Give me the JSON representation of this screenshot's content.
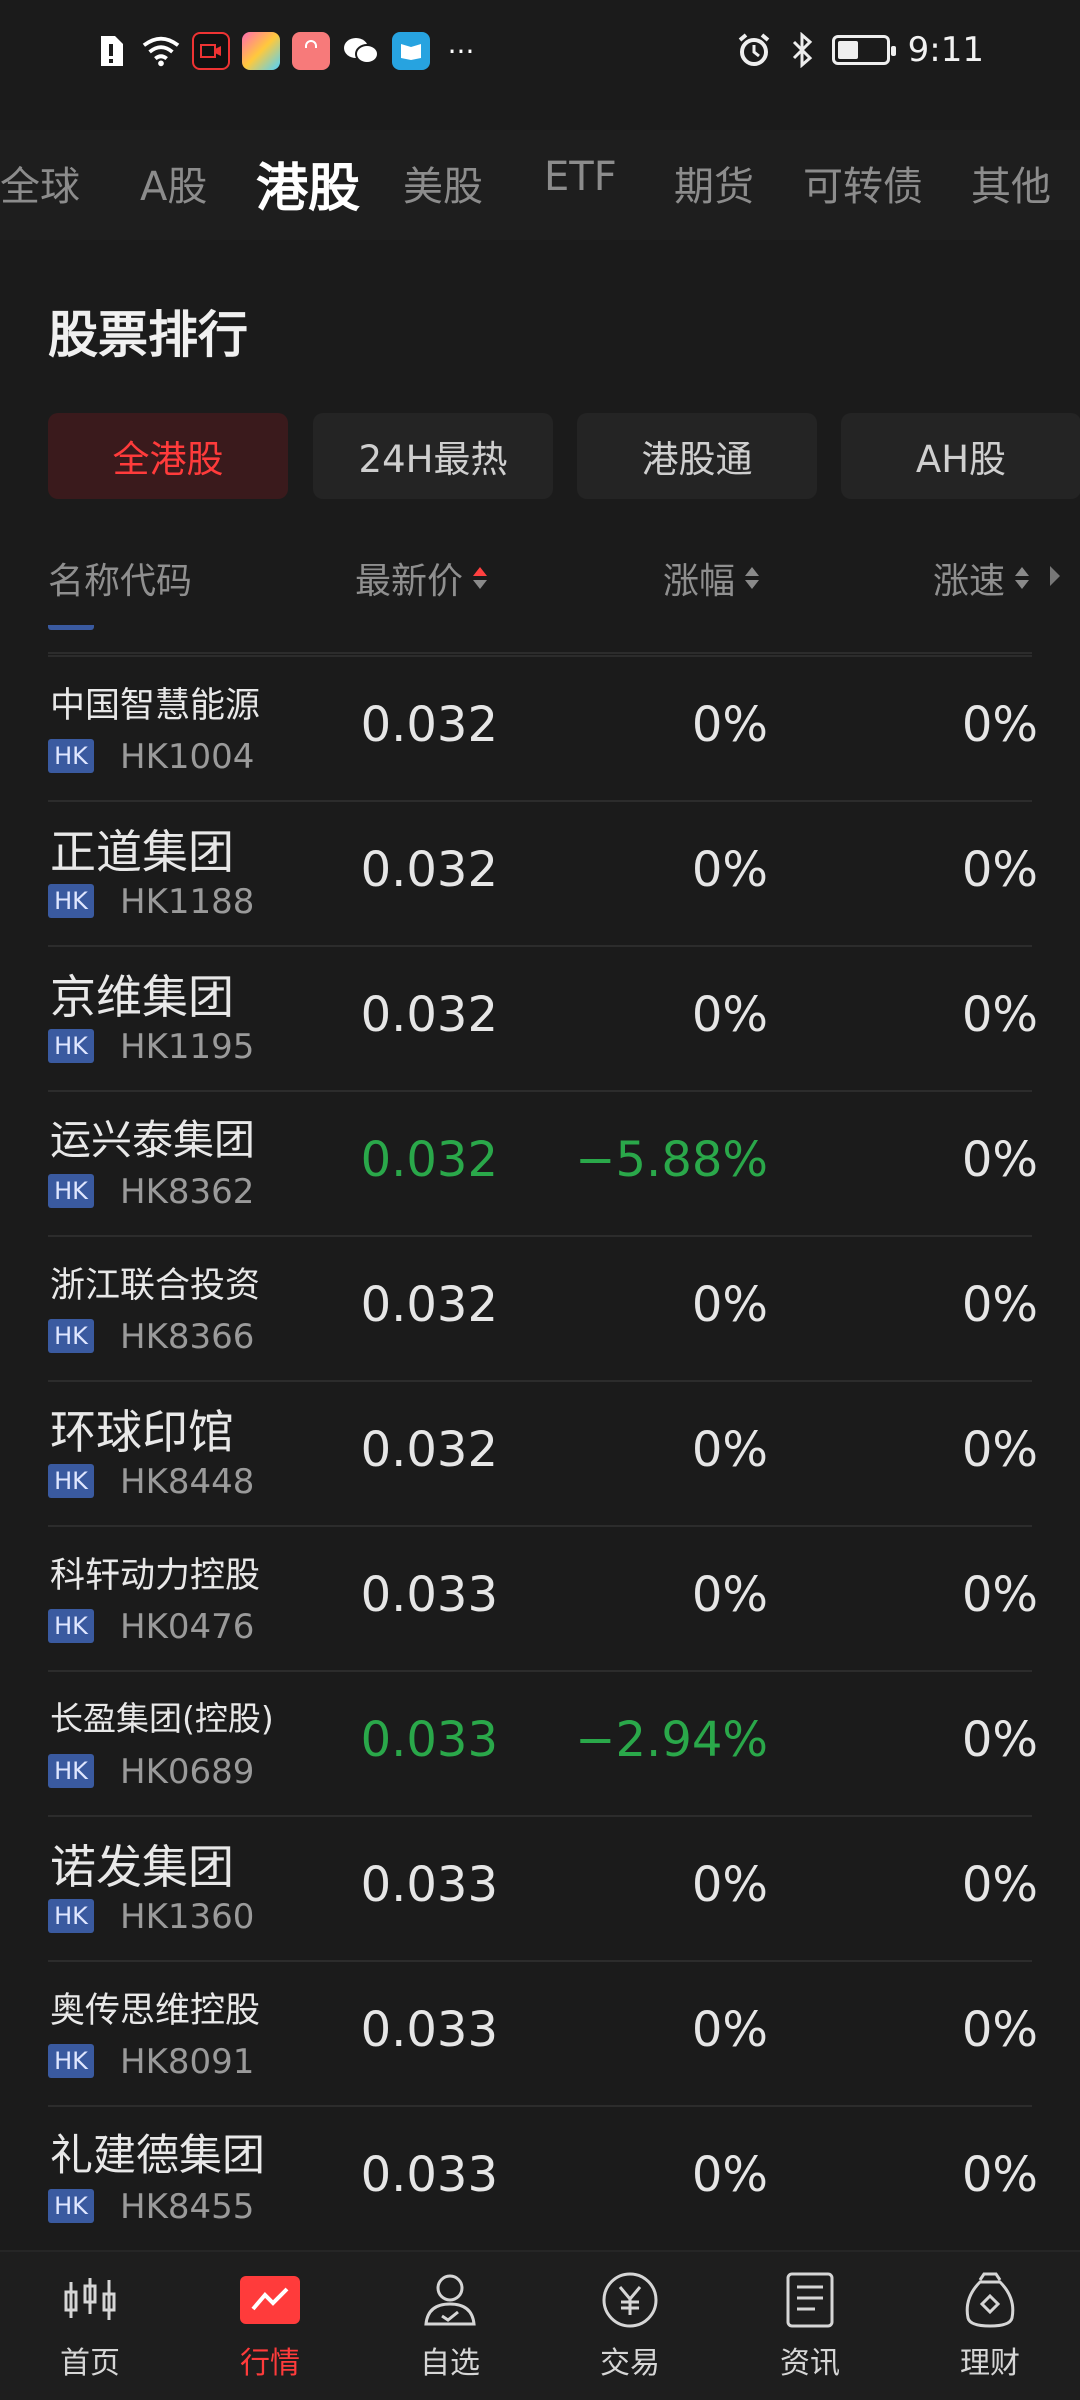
{
  "status_bar": {
    "time": "9:11"
  },
  "market_tabs": [
    "全球",
    "A股",
    "港股",
    "美股",
    "ETF",
    "期货",
    "可转债",
    "其他"
  ],
  "market_tab_active": "港股",
  "section": {
    "title": "股票排行"
  },
  "filters": [
    "全港股",
    "24H最热",
    "港股通",
    "AH股"
  ],
  "filter_active": "全港股",
  "columns": {
    "name": "名称代码",
    "price": "最新价",
    "change": "涨幅",
    "speed": "涨速"
  },
  "rows": [
    {
      "name": "中国智慧能源",
      "badge": "HK",
      "code": "HK1004",
      "price": "0.032",
      "change": "0%",
      "speed": "0%",
      "trend": "flat"
    },
    {
      "name": "正道集团",
      "badge": "HK",
      "code": "HK1188",
      "price": "0.032",
      "change": "0%",
      "speed": "0%",
      "trend": "flat"
    },
    {
      "name": "京维集团",
      "badge": "HK",
      "code": "HK1195",
      "price": "0.032",
      "change": "0%",
      "speed": "0%",
      "trend": "flat"
    },
    {
      "name": "运兴泰集团",
      "badge": "HK",
      "code": "HK8362",
      "price": "0.032",
      "change": "−5.88%",
      "speed": "0%",
      "trend": "down"
    },
    {
      "name": "浙江联合投资",
      "badge": "HK",
      "code": "HK8366",
      "price": "0.032",
      "change": "0%",
      "speed": "0%",
      "trend": "flat"
    },
    {
      "name": "环球印馆",
      "badge": "HK",
      "code": "HK8448",
      "price": "0.032",
      "change": "0%",
      "speed": "0%",
      "trend": "flat"
    },
    {
      "name": "科轩动力控股",
      "badge": "HK",
      "code": "HK0476",
      "price": "0.033",
      "change": "0%",
      "speed": "0%",
      "trend": "flat"
    },
    {
      "name": "长盈集团(控股)",
      "badge": "HK",
      "code": "HK0689",
      "price": "0.033",
      "change": "−2.94%",
      "speed": "0%",
      "trend": "down"
    },
    {
      "name": "诺发集团",
      "badge": "HK",
      "code": "HK1360",
      "price": "0.033",
      "change": "0%",
      "speed": "0%",
      "trend": "flat"
    },
    {
      "name": "奥传思维控股",
      "badge": "HK",
      "code": "HK8091",
      "price": "0.033",
      "change": "0%",
      "speed": "0%",
      "trend": "flat"
    },
    {
      "name": "礼建德集团",
      "badge": "HK",
      "code": "HK8455",
      "price": "0.033",
      "change": "0%",
      "speed": "0%",
      "trend": "flat"
    }
  ],
  "bottom_nav": [
    "首页",
    "行情",
    "自选",
    "交易",
    "资讯",
    "理财"
  ],
  "bottom_nav_active": "行情",
  "colors": {
    "accent": "#ff3b3b",
    "down": "#2aa84a",
    "badge": "#3a5aa0"
  }
}
